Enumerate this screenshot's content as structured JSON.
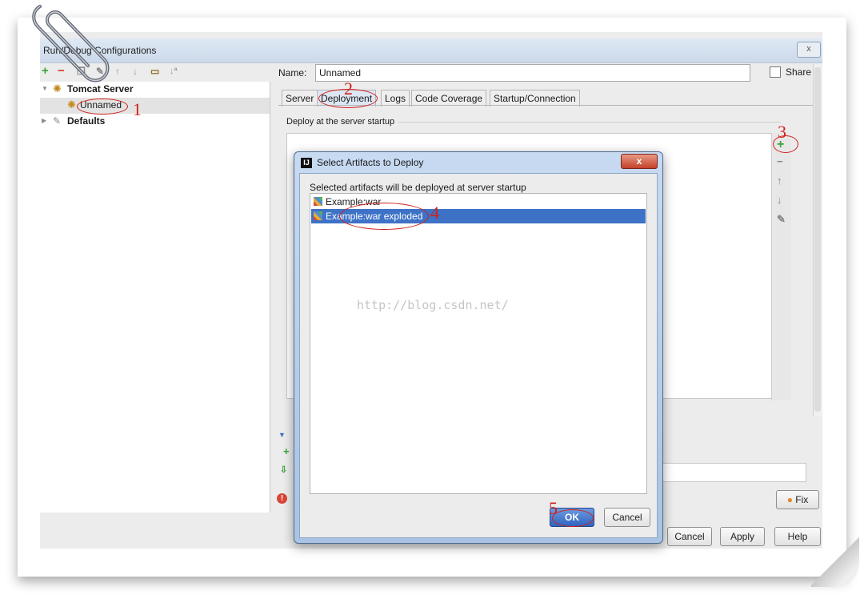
{
  "window": {
    "title": "Run/Debug Configurations",
    "close_glyph": "x"
  },
  "toolbar": {
    "icons": [
      "add-icon",
      "remove-icon",
      "copy-icon",
      "wrench-icon",
      "arrow-up-icon",
      "arrow-down-icon",
      "folder-icon",
      "sort-icon"
    ]
  },
  "tree": {
    "tomcat_server": "Tomcat Server",
    "unnamed": "Unnamed",
    "defaults": "Defaults"
  },
  "config": {
    "name_label": "Name:",
    "name_value": "Unnamed",
    "share_label": "Share",
    "tabs": [
      "Server",
      "Deployment",
      "Logs",
      "Code Coverage",
      "Startup/Connection"
    ],
    "active_tab": "Deployment",
    "deploy_section": "Deploy at the server startup"
  },
  "dialog": {
    "title": "Select Artifacts to Deploy",
    "message": "Selected artifacts will be deployed at server startup",
    "artifacts": [
      {
        "label": "Example:war",
        "selected": false
      },
      {
        "label": "Example:war exploded",
        "selected": true
      }
    ],
    "ok_label": "OK",
    "cancel_label": "Cancel"
  },
  "footer": {
    "fix_label": "Fix",
    "cancel_label": "Cancel",
    "apply_label": "Apply",
    "help_label": "Help"
  },
  "watermark": "http://blog.csdn.net/",
  "annotations": [
    "1",
    "2",
    "3",
    "4",
    "5"
  ],
  "colors": {
    "annotation": "#d0201a",
    "selection": "#3d72c7",
    "add_green": "#3aa23a",
    "remove_red": "#d23a2a"
  }
}
